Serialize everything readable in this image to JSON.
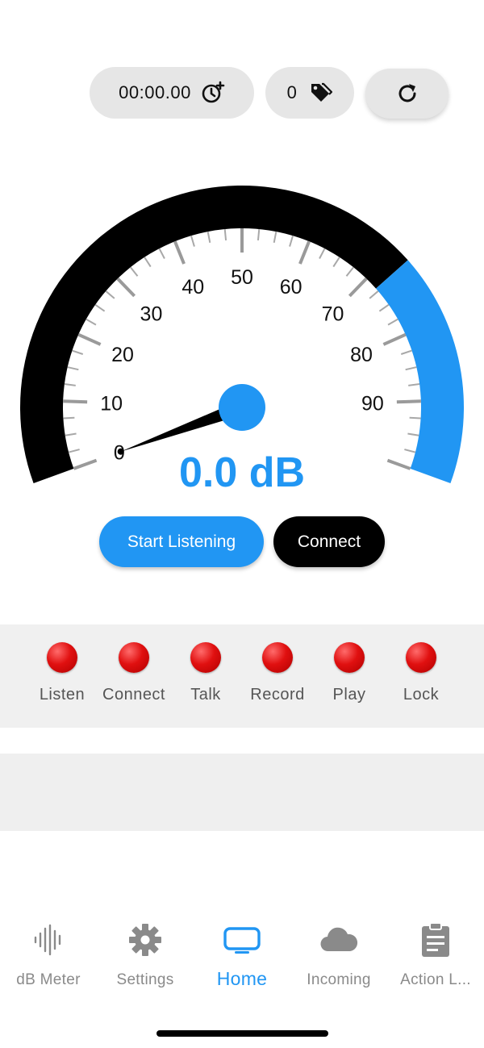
{
  "toolbar": {
    "timer_value": "00:00.00",
    "tag_count": "0",
    "timer_icon": "clock-add-icon",
    "tag_icon": "tags-icon",
    "reset_icon": "refresh-icon"
  },
  "gauge": {
    "min": 0,
    "max": 100,
    "ticks": [
      "0",
      "10",
      "20",
      "30",
      "40",
      "50",
      "60",
      "70",
      "80",
      "90"
    ],
    "current_value": 0.0,
    "readout": "0.0 dB",
    "threshold_start": 72,
    "colors": {
      "arc_normal": "#000000",
      "arc_threshold": "#2196F3",
      "needle": "#000000",
      "hub": "#2196F3"
    }
  },
  "actions": {
    "start_label": "Start Listening",
    "connect_label": "Connect"
  },
  "status": {
    "items": [
      {
        "label": "Listen",
        "state": "off"
      },
      {
        "label": "Connect",
        "state": "off"
      },
      {
        "label": "Talk",
        "state": "off"
      },
      {
        "label": "Record",
        "state": "off"
      },
      {
        "label": "Play",
        "state": "off"
      },
      {
        "label": "Lock",
        "state": "off"
      }
    ]
  },
  "tabs": {
    "items": [
      {
        "label": "dB Meter",
        "icon": "waveform-icon",
        "active": false
      },
      {
        "label": "Settings",
        "icon": "gear-icon",
        "active": false
      },
      {
        "label": "Home",
        "icon": "tv-icon",
        "active": true
      },
      {
        "label": "Incoming",
        "icon": "cloud-icon",
        "active": false
      },
      {
        "label": "Action L...",
        "icon": "clipboard-icon",
        "active": false
      }
    ]
  },
  "theme": {
    "accent": "#2196F3",
    "inactive": "#8a8a8a",
    "led_off": "#e01010"
  }
}
